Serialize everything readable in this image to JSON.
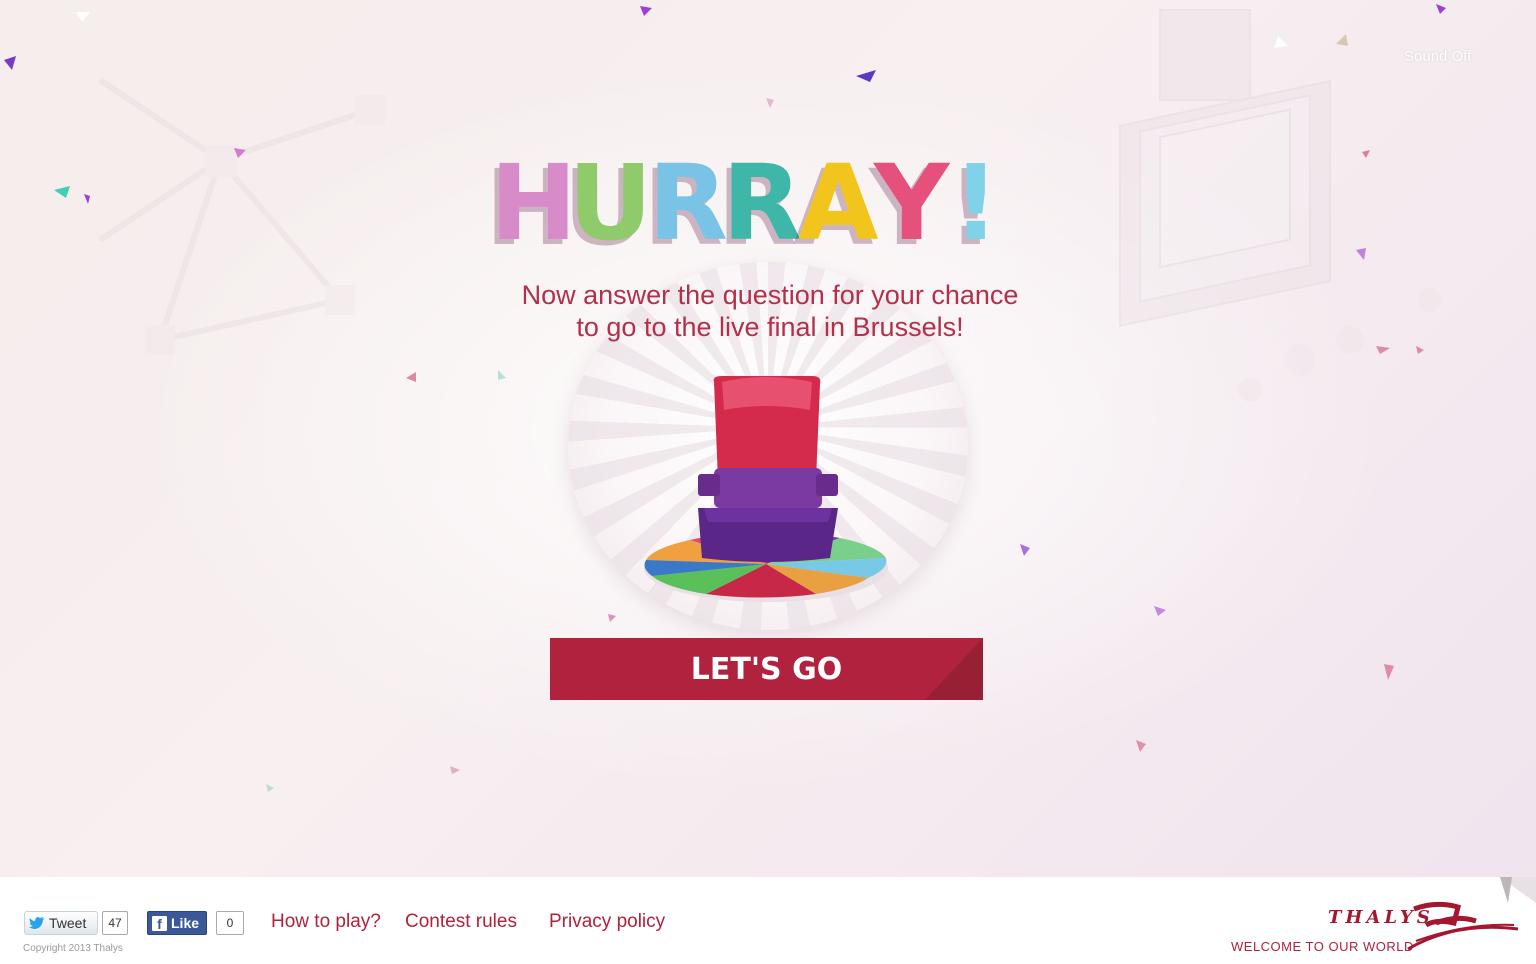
{
  "header": {
    "sound_toggle_label": "Sound Off"
  },
  "hero": {
    "headline_letters": [
      {
        "char": "H",
        "color": "#d78bc9"
      },
      {
        "char": "U",
        "color": "#8fcb6a"
      },
      {
        "char": "R",
        "color": "#78c3e6"
      },
      {
        "char": "R",
        "color": "#3fb7a8"
      },
      {
        "char": "A",
        "color": "#f2c51c"
      },
      {
        "char": "Y",
        "color": "#e5517c"
      },
      {
        "char": "!",
        "color": "#7fd2e8"
      }
    ],
    "subtitle_line1": "Now answer the question for your chance",
    "subtitle_line2": "to go to the live final in Brussels!",
    "cta_label": "LET'S GO",
    "accent_color": "#b0223d"
  },
  "footer": {
    "tweet_label": "Tweet",
    "tweet_count": "47",
    "like_label": "Like",
    "like_count": "0",
    "copyright": "Copyright 2013 Thalys",
    "links": {
      "how_to_play": "How to play?",
      "contest_rules": "Contest rules",
      "privacy_policy": "Privacy policy"
    },
    "brand_name": "THALYS",
    "brand_tagline": "WELCOME TO OUR WORLD"
  },
  "icons": [
    "twitter-bird-icon",
    "facebook-icon",
    "thalys-logo-icon",
    "seat-illustration"
  ]
}
